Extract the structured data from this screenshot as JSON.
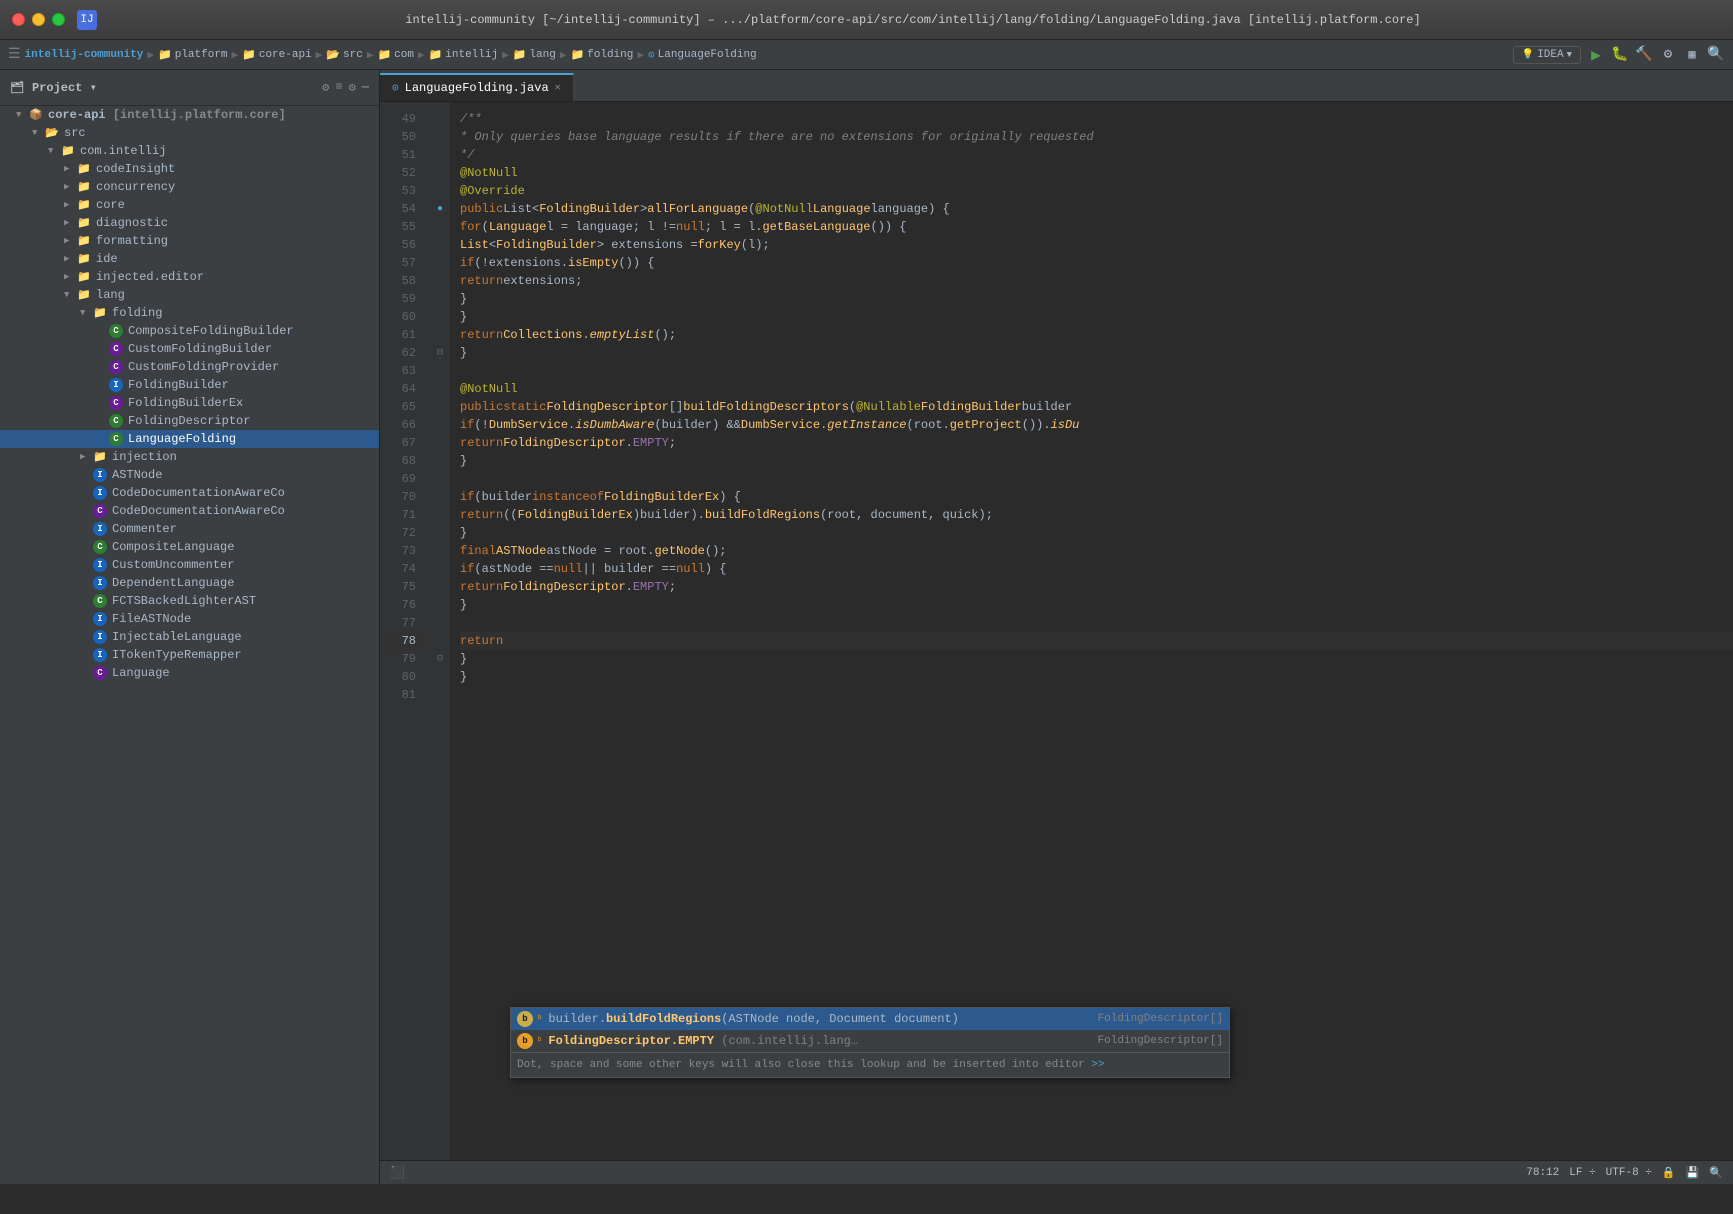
{
  "titlebar": {
    "title": "intellij-community [~/intellij-community] – .../platform/core-api/src/com/intellij/lang/folding/LanguageFolding.java [intellij.platform.core]",
    "app_icon_label": "IJ"
  },
  "breadcrumbs": [
    {
      "label": "intellij-community",
      "type": "project"
    },
    {
      "label": "platform",
      "type": "folder"
    },
    {
      "label": "core-api",
      "type": "folder"
    },
    {
      "label": "src",
      "type": "folder"
    },
    {
      "label": "com",
      "type": "folder"
    },
    {
      "label": "intellij",
      "type": "folder"
    },
    {
      "label": "lang",
      "type": "folder"
    },
    {
      "label": "folding",
      "type": "folder"
    },
    {
      "label": "LanguageFolding",
      "type": "class"
    }
  ],
  "toolbar": {
    "idea_label": "IDEA",
    "run_label": "▶",
    "debug_label": "🐛"
  },
  "sidebar": {
    "title": "Project",
    "tree": [
      {
        "id": "core-api",
        "label": "core-api [intellij.platform.core]",
        "type": "module",
        "indent": 0,
        "expanded": true
      },
      {
        "id": "src",
        "label": "src",
        "type": "folder-src",
        "indent": 1,
        "expanded": true
      },
      {
        "id": "com.intellij",
        "label": "com.intellij",
        "type": "package",
        "indent": 2,
        "expanded": true
      },
      {
        "id": "codeInsight",
        "label": "codeInsight",
        "type": "folder",
        "indent": 3,
        "expanded": false
      },
      {
        "id": "concurrency",
        "label": "concurrency",
        "type": "folder",
        "indent": 3,
        "expanded": false
      },
      {
        "id": "core",
        "label": "core",
        "type": "folder",
        "indent": 3,
        "expanded": false
      },
      {
        "id": "diagnostic",
        "label": "diagnostic",
        "type": "folder",
        "indent": 3,
        "expanded": false
      },
      {
        "id": "formatting",
        "label": "formatting",
        "type": "folder",
        "indent": 3,
        "expanded": false
      },
      {
        "id": "ide",
        "label": "ide",
        "type": "folder",
        "indent": 3,
        "expanded": false
      },
      {
        "id": "injected.editor",
        "label": "injected.editor",
        "type": "folder",
        "indent": 3,
        "expanded": false
      },
      {
        "id": "lang",
        "label": "lang",
        "type": "folder",
        "indent": 3,
        "expanded": true
      },
      {
        "id": "folding",
        "label": "folding",
        "type": "folder",
        "indent": 4,
        "expanded": true
      },
      {
        "id": "CompositeFoldingBuilder",
        "label": "CompositeFoldingBuilder",
        "type": "class-c",
        "indent": 5
      },
      {
        "id": "CustomFoldingBuilder",
        "label": "CustomFoldingBuilder",
        "type": "class-ci",
        "indent": 5
      },
      {
        "id": "CustomFoldingProvider",
        "label": "CustomFoldingProvider",
        "type": "class-ci",
        "indent": 5
      },
      {
        "id": "FoldingBuilder",
        "label": "FoldingBuilder",
        "type": "class-i",
        "indent": 5
      },
      {
        "id": "FoldingBuilderEx",
        "label": "FoldingBuilderEx",
        "type": "class-ci",
        "indent": 5
      },
      {
        "id": "FoldingDescriptor",
        "label": "FoldingDescriptor",
        "type": "class-c",
        "indent": 5
      },
      {
        "id": "LanguageFolding",
        "label": "LanguageFolding",
        "type": "class-c",
        "indent": 5,
        "selected": true
      },
      {
        "id": "injection",
        "label": "injection",
        "type": "folder",
        "indent": 4,
        "expanded": false
      },
      {
        "id": "ASTNode",
        "label": "ASTNode",
        "type": "class-i",
        "indent": 4
      },
      {
        "id": "CodeDocumentationAwareCo1",
        "label": "CodeDocumentationAwareCo",
        "type": "class-i",
        "indent": 4
      },
      {
        "id": "CodeDocumentationAwareCo2",
        "label": "CodeDocumentationAwareCo",
        "type": "class-ci",
        "indent": 4
      },
      {
        "id": "Commenter",
        "label": "Commenter",
        "type": "class-i",
        "indent": 4
      },
      {
        "id": "CompositeLanguage",
        "label": "CompositeLanguage",
        "type": "class-c",
        "indent": 4
      },
      {
        "id": "CustomUncommenter",
        "label": "CustomUncommenter",
        "type": "class-i",
        "indent": 4
      },
      {
        "id": "DependentLanguage",
        "label": "DependentLanguage",
        "type": "class-i",
        "indent": 4
      },
      {
        "id": "FCTSBackedLighterAST",
        "label": "FCTSBackedLighterAST",
        "type": "class-c",
        "indent": 4
      },
      {
        "id": "FileASTNode",
        "label": "FileASTNode",
        "type": "class-i",
        "indent": 4
      },
      {
        "id": "InjectableLanguage",
        "label": "InjectableLanguage",
        "type": "class-i",
        "indent": 4
      },
      {
        "id": "ITokenTypeRemapper",
        "label": "ITokenTypeRemapper",
        "type": "class-i",
        "indent": 4
      },
      {
        "id": "Language",
        "label": "Language",
        "type": "class-ci",
        "indent": 4
      }
    ]
  },
  "tab": {
    "label": "LanguageFolding.java"
  },
  "code": {
    "lines": [
      {
        "num": 49,
        "content": "    /**",
        "type": "comment"
      },
      {
        "num": 50,
        "content": "     * Only queries base language results if there are no extensions for originally requested",
        "type": "comment"
      },
      {
        "num": 51,
        "content": "     */",
        "type": "comment"
      },
      {
        "num": 52,
        "content": "    @NotNull",
        "type": "annotation"
      },
      {
        "num": 53,
        "content": "    @Override",
        "type": "annotation"
      },
      {
        "num": 54,
        "content": "    public List<FoldingBuilder> allForLanguage(@NotNull Language language) {",
        "type": "code",
        "has_breakpoint": false,
        "has_exec": true
      },
      {
        "num": 55,
        "content": "        for (Language l = language; l != null; l = l.getBaseLanguage()) {",
        "type": "code"
      },
      {
        "num": 56,
        "content": "            List<FoldingBuilder> extensions = forKey(l);",
        "type": "code"
      },
      {
        "num": 57,
        "content": "            if (!extensions.isEmpty()) {",
        "type": "code"
      },
      {
        "num": 58,
        "content": "                return extensions;",
        "type": "code"
      },
      {
        "num": 59,
        "content": "            }",
        "type": "code"
      },
      {
        "num": 60,
        "content": "        }",
        "type": "code"
      },
      {
        "num": 61,
        "content": "        return Collections.emptyList();",
        "type": "code"
      },
      {
        "num": 62,
        "content": "    }",
        "type": "code",
        "has_fold": true
      },
      {
        "num": 63,
        "content": "",
        "type": "empty"
      },
      {
        "num": 64,
        "content": "    @NotNull",
        "type": "annotation"
      },
      {
        "num": 65,
        "content": "    public static FoldingDescriptor[] buildFoldingDescriptors(@Nullable FoldingBuilder builder",
        "type": "code"
      },
      {
        "num": 66,
        "content": "        if (!DumbService.isDumbAware(builder) && DumbService.getInstance(root.getProject()).isDu",
        "type": "code"
      },
      {
        "num": 67,
        "content": "            return FoldingDescriptor.EMPTY;",
        "type": "code"
      },
      {
        "num": 68,
        "content": "        }",
        "type": "code"
      },
      {
        "num": 69,
        "content": "",
        "type": "empty"
      },
      {
        "num": 70,
        "content": "        if (builder instanceof FoldingBuilderEx) {",
        "type": "code"
      },
      {
        "num": 71,
        "content": "            return ((FoldingBuilderEx)builder).buildFoldRegions(root, document, quick);",
        "type": "code"
      },
      {
        "num": 72,
        "content": "        }",
        "type": "code"
      },
      {
        "num": 73,
        "content": "        final ASTNode astNode = root.getNode();",
        "type": "code"
      },
      {
        "num": 74,
        "content": "        if (astNode == null || builder == null) {",
        "type": "code"
      },
      {
        "num": 75,
        "content": "            return FoldingDescriptor.EMPTY;",
        "type": "code"
      },
      {
        "num": 76,
        "content": "        }",
        "type": "code"
      },
      {
        "num": 77,
        "content": "",
        "type": "empty"
      },
      {
        "num": 78,
        "content": "        return |",
        "type": "code",
        "is_current": true
      },
      {
        "num": 79,
        "content": "    }",
        "type": "code"
      },
      {
        "num": 80,
        "content": "}",
        "type": "code"
      },
      {
        "num": 81,
        "content": "",
        "type": "empty"
      }
    ]
  },
  "autocomplete": {
    "items": [
      {
        "icon_type": "method-yellow",
        "icon_label": "b",
        "secondary_icon": "orange",
        "text_prefix": "builder.",
        "method_name": "buildFoldRegions",
        "params": "(ASTNode node, Document document)",
        "return_type": "FoldingDescriptor[]",
        "selected": true
      },
      {
        "icon_type": "method-orange",
        "icon_label": "b",
        "secondary_icon": "orange",
        "text_prefix": "",
        "method_name": "FoldingDescriptor.EMPTY",
        "params": " (com.intellij.lang…",
        "return_type": "FoldingDescriptor[]",
        "selected": false
      }
    ],
    "hint": "Dot, space and some other keys will also close this lookup and be inserted into editor",
    "hint_link": ">>"
  },
  "status": {
    "position": "78:12",
    "line_ending": "LF",
    "encoding": "UTF-8 ÷",
    "icons": [
      "🔒",
      "💾",
      "🔍"
    ]
  }
}
